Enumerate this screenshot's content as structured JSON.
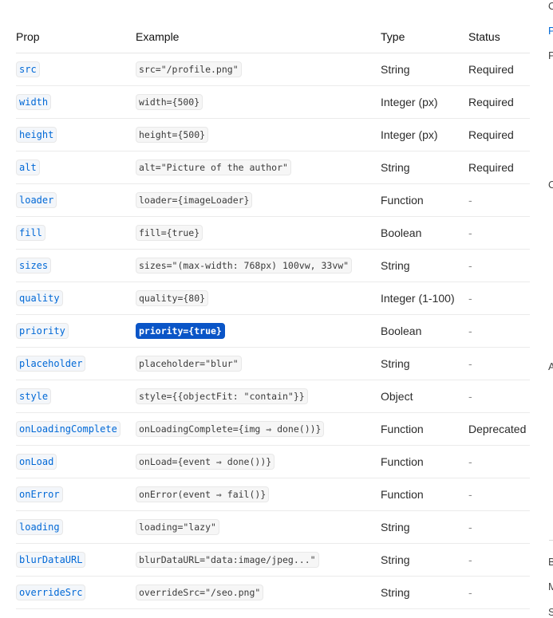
{
  "table": {
    "headers": {
      "prop": "Prop",
      "example": "Example",
      "type": "Type",
      "status": "Status"
    },
    "rows": [
      {
        "prop": "src",
        "example": "src=\"/profile.png\"",
        "type": "String",
        "status": "Required"
      },
      {
        "prop": "width",
        "example": "width={500}",
        "type": "Integer (px)",
        "status": "Required"
      },
      {
        "prop": "height",
        "example": "height={500}",
        "type": "Integer (px)",
        "status": "Required"
      },
      {
        "prop": "alt",
        "example": "alt=\"Picture of the author\"",
        "type": "String",
        "status": "Required"
      },
      {
        "prop": "loader",
        "example": "loader={imageLoader}",
        "type": "Function",
        "status": "-"
      },
      {
        "prop": "fill",
        "example": "fill={true}",
        "type": "Boolean",
        "status": "-"
      },
      {
        "prop": "sizes",
        "example": "sizes=\"(max-width: 768px) 100vw, 33vw\"",
        "type": "String",
        "status": "-"
      },
      {
        "prop": "quality",
        "example": "quality={80}",
        "type": "Integer (1-100)",
        "status": "-"
      },
      {
        "prop": "priority",
        "example": "priority={true}",
        "type": "Boolean",
        "status": "-",
        "selected": true
      },
      {
        "prop": "placeholder",
        "example": "placeholder=\"blur\"",
        "type": "String",
        "status": "-"
      },
      {
        "prop": "style",
        "example": "style={{objectFit: \"contain\"}}",
        "type": "Object",
        "status": "-"
      },
      {
        "prop": "onLoadingComplete",
        "example": "onLoadingComplete={img ⇒ done())}",
        "type": "Function",
        "status": "Deprecated"
      },
      {
        "prop": "onLoad",
        "example": "onLoad={event ⇒ done())}",
        "type": "Function",
        "status": "-"
      },
      {
        "prop": "onError",
        "example": "onError(event ⇒ fail()}",
        "type": "Function",
        "status": "-"
      },
      {
        "prop": "loading",
        "example": "loading=\"lazy\"",
        "type": "String",
        "status": "-"
      },
      {
        "prop": "blurDataURL",
        "example": "blurDataURL=\"data:image/jpeg...\"",
        "type": "String",
        "status": "-"
      },
      {
        "prop": "overrideSrc",
        "example": "overrideSrc=\"/seo.png\"",
        "type": "String",
        "status": "-"
      }
    ]
  },
  "sidebar_edge": {
    "fragments": [
      "O",
      "P",
      "P",
      "O",
      "A",
      "B",
      "M",
      "S"
    ]
  },
  "colors": {
    "prop_code_text": "#0068d6",
    "selection_bg": "#0a55c7",
    "row_border": "#ebebeb"
  }
}
